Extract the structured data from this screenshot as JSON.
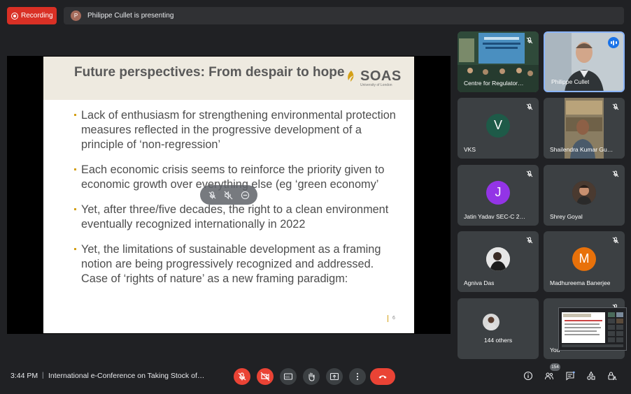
{
  "top": {
    "recording_label": "Recording",
    "presenter_initial": "P",
    "presenting_text": "Philippe Cullet is presenting"
  },
  "slide": {
    "title": "Future perspectives: From despair to hope",
    "logo_name": "SOAS",
    "logo_sub": "University of London",
    "bullets": [
      "Lack of enthusiasm for strengthening environmental protection measures reflected in the progressive development of a principle of ‘non-regression’",
      "Each economic crisis seems to reinforce the priority given to economic growth over everything else (eg ‘green economy’",
      "Yet, after three/five decades, the right to a clean environment eventually recognized internationally in 2022",
      "Yet, the limitations of sustainable development as a framing notion are being progressively recognized and addressed. Case of ‘rights of nature’ as a new framing paradigm:"
    ],
    "page_number": "6"
  },
  "tiles": [
    {
      "name": "Centre for Regulator…",
      "type": "video-room"
    },
    {
      "name": "Philippe Cullet",
      "type": "video-person",
      "speaking": true
    },
    {
      "name": "VKS",
      "initial": "V",
      "color": "#1e5a48"
    },
    {
      "name": "Shailendra Kumar Gu…",
      "type": "video-person2"
    },
    {
      "name": "Jatin Yadav SEC-C 2…",
      "initial": "J",
      "color": "#9334e6"
    },
    {
      "name": "Shrey Goyal",
      "type": "photo"
    },
    {
      "name": "Agniva Das",
      "type": "photo"
    },
    {
      "name": "Madhureema Banerjee",
      "initial": "M",
      "color": "#e8710a"
    },
    {
      "name": "144 others",
      "type": "others"
    },
    {
      "name": "You",
      "type": "self"
    }
  ],
  "bottom": {
    "time": "3:44 PM",
    "separator": "|",
    "meeting_title": "International e-Conference on Taking Stock of…",
    "participant_count": "154"
  },
  "colors": {
    "danger": "#ea4335",
    "panel": "#3c4043",
    "background": "#202124",
    "accent": "#8ab4f8"
  }
}
